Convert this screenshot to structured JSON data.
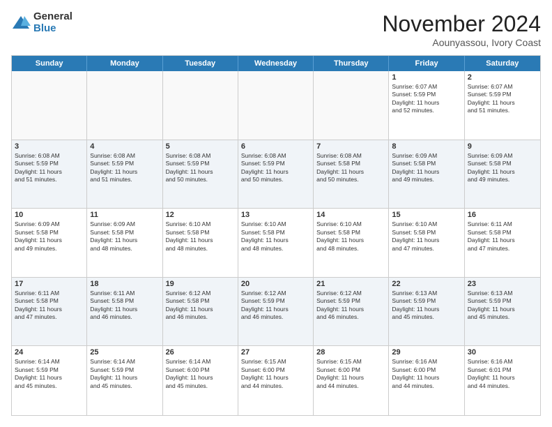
{
  "logo": {
    "general": "General",
    "blue": "Blue"
  },
  "title": "November 2024",
  "location": "Aounyassou, Ivory Coast",
  "header_days": [
    "Sunday",
    "Monday",
    "Tuesday",
    "Wednesday",
    "Thursday",
    "Friday",
    "Saturday"
  ],
  "weeks": [
    [
      {
        "date": "",
        "info": "",
        "empty": true
      },
      {
        "date": "",
        "info": "",
        "empty": true
      },
      {
        "date": "",
        "info": "",
        "empty": true
      },
      {
        "date": "",
        "info": "",
        "empty": true
      },
      {
        "date": "",
        "info": "",
        "empty": true
      },
      {
        "date": "1",
        "info": "Sunrise: 6:07 AM\nSunset: 5:59 PM\nDaylight: 11 hours\nand 52 minutes.",
        "empty": false
      },
      {
        "date": "2",
        "info": "Sunrise: 6:07 AM\nSunset: 5:59 PM\nDaylight: 11 hours\nand 51 minutes.",
        "empty": false
      }
    ],
    [
      {
        "date": "3",
        "info": "Sunrise: 6:08 AM\nSunset: 5:59 PM\nDaylight: 11 hours\nand 51 minutes.",
        "empty": false
      },
      {
        "date": "4",
        "info": "Sunrise: 6:08 AM\nSunset: 5:59 PM\nDaylight: 11 hours\nand 51 minutes.",
        "empty": false
      },
      {
        "date": "5",
        "info": "Sunrise: 6:08 AM\nSunset: 5:59 PM\nDaylight: 11 hours\nand 50 minutes.",
        "empty": false
      },
      {
        "date": "6",
        "info": "Sunrise: 6:08 AM\nSunset: 5:59 PM\nDaylight: 11 hours\nand 50 minutes.",
        "empty": false
      },
      {
        "date": "7",
        "info": "Sunrise: 6:08 AM\nSunset: 5:58 PM\nDaylight: 11 hours\nand 50 minutes.",
        "empty": false
      },
      {
        "date": "8",
        "info": "Sunrise: 6:09 AM\nSunset: 5:58 PM\nDaylight: 11 hours\nand 49 minutes.",
        "empty": false
      },
      {
        "date": "9",
        "info": "Sunrise: 6:09 AM\nSunset: 5:58 PM\nDaylight: 11 hours\nand 49 minutes.",
        "empty": false
      }
    ],
    [
      {
        "date": "10",
        "info": "Sunrise: 6:09 AM\nSunset: 5:58 PM\nDaylight: 11 hours\nand 49 minutes.",
        "empty": false
      },
      {
        "date": "11",
        "info": "Sunrise: 6:09 AM\nSunset: 5:58 PM\nDaylight: 11 hours\nand 48 minutes.",
        "empty": false
      },
      {
        "date": "12",
        "info": "Sunrise: 6:10 AM\nSunset: 5:58 PM\nDaylight: 11 hours\nand 48 minutes.",
        "empty": false
      },
      {
        "date": "13",
        "info": "Sunrise: 6:10 AM\nSunset: 5:58 PM\nDaylight: 11 hours\nand 48 minutes.",
        "empty": false
      },
      {
        "date": "14",
        "info": "Sunrise: 6:10 AM\nSunset: 5:58 PM\nDaylight: 11 hours\nand 48 minutes.",
        "empty": false
      },
      {
        "date": "15",
        "info": "Sunrise: 6:10 AM\nSunset: 5:58 PM\nDaylight: 11 hours\nand 47 minutes.",
        "empty": false
      },
      {
        "date": "16",
        "info": "Sunrise: 6:11 AM\nSunset: 5:58 PM\nDaylight: 11 hours\nand 47 minutes.",
        "empty": false
      }
    ],
    [
      {
        "date": "17",
        "info": "Sunrise: 6:11 AM\nSunset: 5:58 PM\nDaylight: 11 hours\nand 47 minutes.",
        "empty": false
      },
      {
        "date": "18",
        "info": "Sunrise: 6:11 AM\nSunset: 5:58 PM\nDaylight: 11 hours\nand 46 minutes.",
        "empty": false
      },
      {
        "date": "19",
        "info": "Sunrise: 6:12 AM\nSunset: 5:58 PM\nDaylight: 11 hours\nand 46 minutes.",
        "empty": false
      },
      {
        "date": "20",
        "info": "Sunrise: 6:12 AM\nSunset: 5:59 PM\nDaylight: 11 hours\nand 46 minutes.",
        "empty": false
      },
      {
        "date": "21",
        "info": "Sunrise: 6:12 AM\nSunset: 5:59 PM\nDaylight: 11 hours\nand 46 minutes.",
        "empty": false
      },
      {
        "date": "22",
        "info": "Sunrise: 6:13 AM\nSunset: 5:59 PM\nDaylight: 11 hours\nand 45 minutes.",
        "empty": false
      },
      {
        "date": "23",
        "info": "Sunrise: 6:13 AM\nSunset: 5:59 PM\nDaylight: 11 hours\nand 45 minutes.",
        "empty": false
      }
    ],
    [
      {
        "date": "24",
        "info": "Sunrise: 6:14 AM\nSunset: 5:59 PM\nDaylight: 11 hours\nand 45 minutes.",
        "empty": false
      },
      {
        "date": "25",
        "info": "Sunrise: 6:14 AM\nSunset: 5:59 PM\nDaylight: 11 hours\nand 45 minutes.",
        "empty": false
      },
      {
        "date": "26",
        "info": "Sunrise: 6:14 AM\nSunset: 6:00 PM\nDaylight: 11 hours\nand 45 minutes.",
        "empty": false
      },
      {
        "date": "27",
        "info": "Sunrise: 6:15 AM\nSunset: 6:00 PM\nDaylight: 11 hours\nand 44 minutes.",
        "empty": false
      },
      {
        "date": "28",
        "info": "Sunrise: 6:15 AM\nSunset: 6:00 PM\nDaylight: 11 hours\nand 44 minutes.",
        "empty": false
      },
      {
        "date": "29",
        "info": "Sunrise: 6:16 AM\nSunset: 6:00 PM\nDaylight: 11 hours\nand 44 minutes.",
        "empty": false
      },
      {
        "date": "30",
        "info": "Sunrise: 6:16 AM\nSunset: 6:01 PM\nDaylight: 11 hours\nand 44 minutes.",
        "empty": false
      }
    ]
  ]
}
